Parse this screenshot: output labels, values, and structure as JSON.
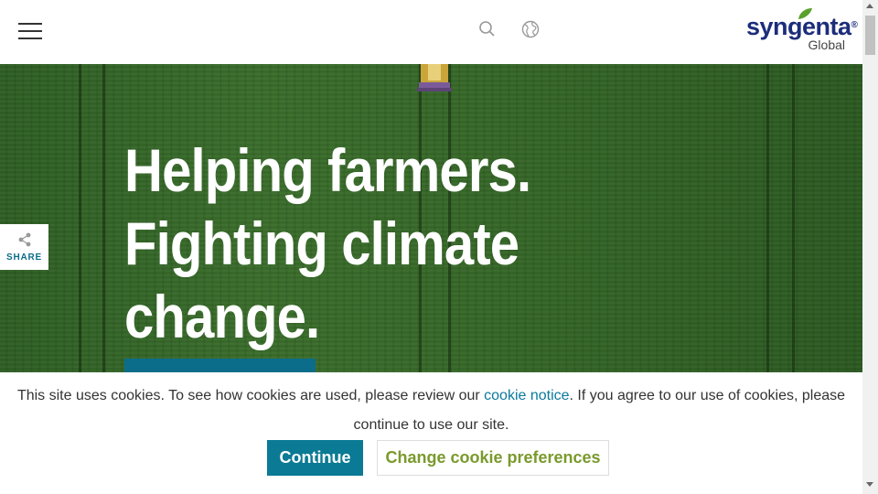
{
  "header": {
    "menu_icon": "hamburger-menu-icon",
    "search_icon": "search-icon",
    "globe_icon": "globe-icon",
    "logo": {
      "wordmark": "syngenta",
      "registered": "®",
      "subtitle": "Global",
      "brand_color": "#1c2d7a",
      "leaf_color": "#5aa02c"
    }
  },
  "hero": {
    "title_line1": "Helping farmers.",
    "title_line2": "Fighting climate",
    "title_line3": "change.",
    "cta_color": "#0b6d8a"
  },
  "share": {
    "icon": "share-icon",
    "label": "SHARE"
  },
  "cookie_banner": {
    "text_before": "This site uses cookies. To see how cookies are used, please review our ",
    "link_text": "cookie notice",
    "text_after": ". If you agree to our use of cookies, please continue to use our site.",
    "continue_label": "Continue",
    "preferences_label": "Change cookie preferences",
    "accent_color": "#0b7a94",
    "secondary_color": "#7a9a2c"
  }
}
